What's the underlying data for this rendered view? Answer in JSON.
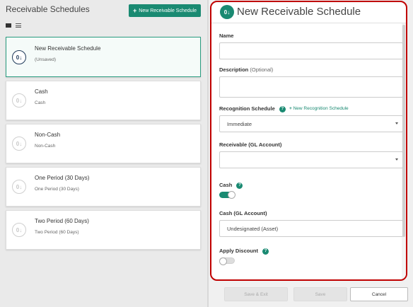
{
  "left": {
    "title": "Receivable Schedules",
    "new_button": "New Receivable Schedule",
    "cards": [
      {
        "title": "New Receivable Schedule",
        "subtitle": "(Unsaved)"
      },
      {
        "title": "Cash",
        "subtitle": "Cash"
      },
      {
        "title": "Non-Cash",
        "subtitle": "Non-Cash"
      },
      {
        "title": "One Period (30 Days)",
        "subtitle": "One Period (30 Days)"
      },
      {
        "title": "Two Period (60 Days)",
        "subtitle": "Two Period (60 Days)"
      }
    ]
  },
  "panel": {
    "title": "New Receivable Schedule",
    "name_label": "Name",
    "name_value": "",
    "description_label": "Description",
    "description_optional": "(Optional)",
    "description_value": "",
    "recognition_label": "Recognition Schedule",
    "recognition_link": "New Recognition Schedule",
    "recognition_value": "Immediate",
    "receivable_gl_label": "Receivable (GL Account)",
    "receivable_gl_value": "",
    "cash_label": "Cash",
    "cash_toggle": true,
    "cash_gl_label": "Cash (GL Account)",
    "cash_gl_value": "Undesignated (Asset)",
    "apply_discount_label": "Apply Discount",
    "apply_discount_toggle": false,
    "help_glyph": "?"
  },
  "footer": {
    "save_exit": "Save & Exit",
    "save": "Save",
    "cancel": "Cancel"
  },
  "colors": {
    "accent": "#1a8a72",
    "highlight_border": "#c00000"
  }
}
